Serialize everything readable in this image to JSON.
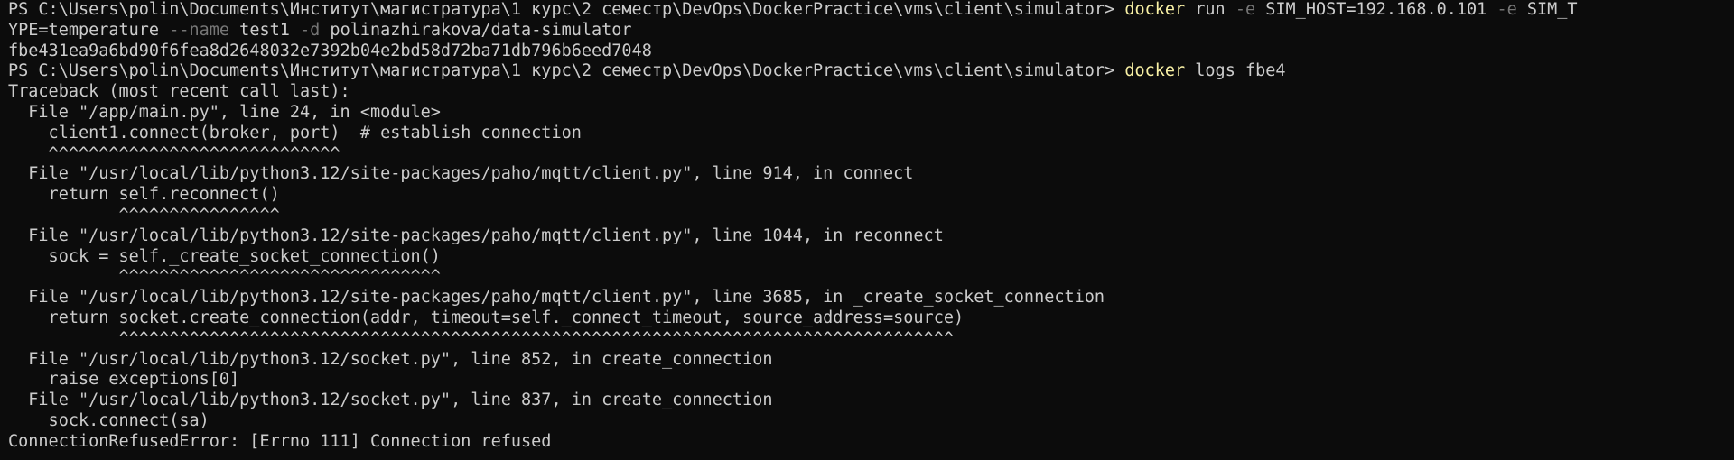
{
  "colors": {
    "background": "#0c0c0c",
    "text": "#cccccc",
    "command": "#f9f1a5",
    "flag": "#767676"
  },
  "session": {
    "prompt": "PS C:\\Users\\polin\\Documents\\Институт\\магистратура\\1 курс\\2 семестр\\DevOps\\DockerPractice\\vms\\client\\simulator> ",
    "run": {
      "command": "docker",
      "sub": " run ",
      "flag_e1": "-e",
      "env1": " SIM_HOST=192.168.0.101 ",
      "flag_e2": "-e",
      "env2_part1": " SIM_T",
      "env2_part2": "YPE=temperature ",
      "flag_name": "--name",
      "name_value": " test1 ",
      "flag_d": "-d",
      "image": " polinazhirakova/data-simulator"
    },
    "container_id": "fbe431ea9a6bd90f6fea8d2648032e7392b04e2bd58d72ba71db796b6eed7048",
    "logs": {
      "command": "docker",
      "args": " logs fbe4"
    },
    "traceback": [
      "Traceback (most recent call last):",
      "  File \"/app/main.py\", line 24, in <module>",
      "    client1.connect(broker, port)  # establish connection",
      "    ^^^^^^^^^^^^^^^^^^^^^^^^^^^^^",
      "  File \"/usr/local/lib/python3.12/site-packages/paho/mqtt/client.py\", line 914, in connect",
      "    return self.reconnect()",
      "           ^^^^^^^^^^^^^^^^",
      "  File \"/usr/local/lib/python3.12/site-packages/paho/mqtt/client.py\", line 1044, in reconnect",
      "    sock = self._create_socket_connection()",
      "           ^^^^^^^^^^^^^^^^^^^^^^^^^^^^^^^^",
      "  File \"/usr/local/lib/python3.12/site-packages/paho/mqtt/client.py\", line 3685, in _create_socket_connection",
      "    return socket.create_connection(addr, timeout=self._connect_timeout, source_address=source)",
      "           ^^^^^^^^^^^^^^^^^^^^^^^^^^^^^^^^^^^^^^^^^^^^^^^^^^^^^^^^^^^^^^^^^^^^^^^^^^^^^^^^^^^",
      "  File \"/usr/local/lib/python3.12/socket.py\", line 852, in create_connection",
      "    raise exceptions[0]",
      "  File \"/usr/local/lib/python3.12/socket.py\", line 837, in create_connection",
      "    sock.connect(sa)",
      "ConnectionRefusedError: [Errno 111] Connection refused"
    ]
  }
}
